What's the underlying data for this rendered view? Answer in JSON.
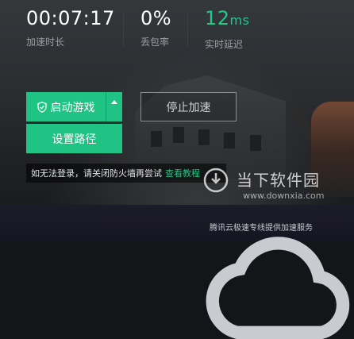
{
  "stats": {
    "duration": {
      "value": "00:07:17",
      "label": "加速时长"
    },
    "packet_loss": {
      "value": "0%",
      "label": "丢包率"
    },
    "latency": {
      "value": "12",
      "unit": "ms",
      "label": "实时延迟"
    }
  },
  "buttons": {
    "start_game": "启动游戏",
    "stop_accel": "停止加速",
    "set_route": "设置路径",
    "dropdown_icon": "triangle-up"
  },
  "tip": {
    "text": "如无法登录，请关闭防火墙再尝试",
    "link": "查看教程"
  },
  "footer": {
    "text": "腾讯云极速专线提供加速服务"
  },
  "watermark": {
    "brand": "当下软件园",
    "url": "www.downxia.com"
  },
  "colors": {
    "accent": "#1fc384",
    "background": "#141518"
  }
}
